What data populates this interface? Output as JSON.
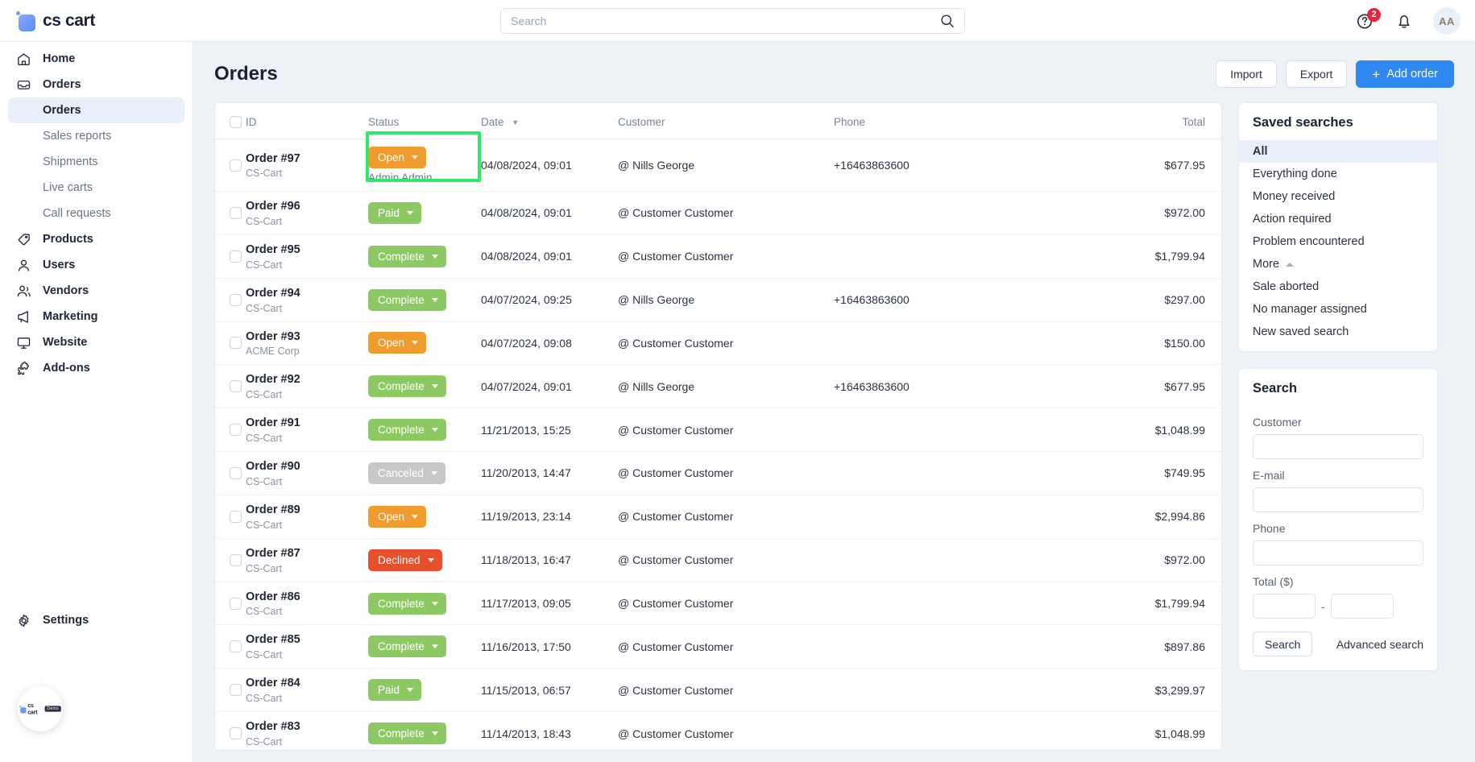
{
  "topbar": {
    "brand": "cs cart",
    "search_placeholder": "Search",
    "search_value": "",
    "help_badge": "2",
    "avatar_initials": "AA"
  },
  "sidebar": {
    "items": [
      {
        "label": "Home",
        "icon": "home-icon",
        "type": "main"
      },
      {
        "label": "Orders",
        "icon": "inbox-icon",
        "type": "main"
      },
      {
        "label": "Orders",
        "icon": "",
        "type": "sub",
        "active": true
      },
      {
        "label": "Sales reports",
        "icon": "",
        "type": "sub"
      },
      {
        "label": "Shipments",
        "icon": "",
        "type": "sub"
      },
      {
        "label": "Live carts",
        "icon": "",
        "type": "sub"
      },
      {
        "label": "Call requests",
        "icon": "",
        "type": "sub"
      },
      {
        "label": "Products",
        "icon": "tag-icon",
        "type": "main"
      },
      {
        "label": "Users",
        "icon": "user-icon",
        "type": "main"
      },
      {
        "label": "Vendors",
        "icon": "users-icon",
        "type": "main"
      },
      {
        "label": "Marketing",
        "icon": "megaphone-icon",
        "type": "main"
      },
      {
        "label": "Website",
        "icon": "monitor-icon",
        "type": "main"
      },
      {
        "label": "Add-ons",
        "icon": "puzzle-icon",
        "type": "main"
      }
    ],
    "settings": {
      "label": "Settings",
      "icon": "gear-icon"
    },
    "demo_widget": {
      "brand": "cs cart",
      "badge": "Demo"
    }
  },
  "page": {
    "title": "Orders",
    "buttons": {
      "import": "Import",
      "export": "Export",
      "add_order": "Add order",
      "add_icon": "plus-icon"
    }
  },
  "table": {
    "columns": [
      "ID",
      "Status",
      "Date",
      "Customer",
      "Phone",
      "Total"
    ],
    "sorted_column": "Date",
    "sort_direction": "desc",
    "status_colors": {
      "Open": "#ef9b2e",
      "Paid": "#8dc963",
      "Complete": "#8dc963",
      "Canceled": "#c8c8c8",
      "Declined": "#e8502c"
    },
    "rows": [
      {
        "id": "Order #97",
        "store": "CS-Cart",
        "status": "Open",
        "assignee": "Admin Admin",
        "highlighted": true,
        "date": "04/08/2024, 09:01",
        "customer": "@ Nills George",
        "phone": "+16463863600",
        "total": "$677.95"
      },
      {
        "id": "Order #96",
        "store": "CS-Cart",
        "status": "Paid",
        "assignee": "",
        "highlighted": false,
        "date": "04/08/2024, 09:01",
        "customer": "@ Customer Customer",
        "phone": "",
        "total": "$972.00"
      },
      {
        "id": "Order #95",
        "store": "CS-Cart",
        "status": "Complete",
        "assignee": "",
        "highlighted": false,
        "date": "04/08/2024, 09:01",
        "customer": "@ Customer Customer",
        "phone": "",
        "total": "$1,799.94"
      },
      {
        "id": "Order #94",
        "store": "CS-Cart",
        "status": "Complete",
        "assignee": "",
        "highlighted": false,
        "date": "04/07/2024, 09:25",
        "customer": "@ Nills George",
        "phone": "+16463863600",
        "total": "$297.00"
      },
      {
        "id": "Order #93",
        "store": "ACME Corp",
        "status": "Open",
        "assignee": "",
        "highlighted": false,
        "date": "04/07/2024, 09:08",
        "customer": "@ Customer Customer",
        "phone": "",
        "total": "$150.00"
      },
      {
        "id": "Order #92",
        "store": "CS-Cart",
        "status": "Complete",
        "assignee": "",
        "highlighted": false,
        "date": "04/07/2024, 09:01",
        "customer": "@ Nills George",
        "phone": "+16463863600",
        "total": "$677.95"
      },
      {
        "id": "Order #91",
        "store": "CS-Cart",
        "status": "Complete",
        "assignee": "",
        "highlighted": false,
        "date": "11/21/2013, 15:25",
        "customer": "@ Customer Customer",
        "phone": "",
        "total": "$1,048.99"
      },
      {
        "id": "Order #90",
        "store": "CS-Cart",
        "status": "Canceled",
        "assignee": "",
        "highlighted": false,
        "date": "11/20/2013, 14:47",
        "customer": "@ Customer Customer",
        "phone": "",
        "total": "$749.95"
      },
      {
        "id": "Order #89",
        "store": "CS-Cart",
        "status": "Open",
        "assignee": "",
        "highlighted": false,
        "date": "11/19/2013, 23:14",
        "customer": "@ Customer Customer",
        "phone": "",
        "total": "$2,994.86"
      },
      {
        "id": "Order #87",
        "store": "CS-Cart",
        "status": "Declined",
        "assignee": "",
        "highlighted": false,
        "date": "11/18/2013, 16:47",
        "customer": "@ Customer Customer",
        "phone": "",
        "total": "$972.00"
      },
      {
        "id": "Order #86",
        "store": "CS-Cart",
        "status": "Complete",
        "assignee": "",
        "highlighted": false,
        "date": "11/17/2013, 09:05",
        "customer": "@ Customer Customer",
        "phone": "",
        "total": "$1,799.94"
      },
      {
        "id": "Order #85",
        "store": "CS-Cart",
        "status": "Complete",
        "assignee": "",
        "highlighted": false,
        "date": "11/16/2013, 17:50",
        "customer": "@ Customer Customer",
        "phone": "",
        "total": "$897.86"
      },
      {
        "id": "Order #84",
        "store": "CS-Cart",
        "status": "Paid",
        "assignee": "",
        "highlighted": false,
        "date": "11/15/2013, 06:57",
        "customer": "@ Customer Customer",
        "phone": "",
        "total": "$3,299.97"
      },
      {
        "id": "Order #83",
        "store": "CS-Cart",
        "status": "Complete",
        "assignee": "",
        "highlighted": false,
        "date": "11/14/2013, 18:43",
        "customer": "@ Customer Customer",
        "phone": "",
        "total": "$1,048.99"
      }
    ]
  },
  "saved_searches": {
    "title": "Saved searches",
    "items": [
      {
        "label": "All",
        "active": true
      },
      {
        "label": "Everything done",
        "active": false
      },
      {
        "label": "Money received",
        "active": false
      },
      {
        "label": "Action required",
        "active": false
      },
      {
        "label": "Problem encountered",
        "active": false
      },
      {
        "label": "More",
        "active": false,
        "chevron": "chevron-up-icon"
      },
      {
        "label": "Sale aborted",
        "active": false
      },
      {
        "label": "No manager assigned",
        "active": false
      },
      {
        "label": "New saved search",
        "active": false
      }
    ]
  },
  "search_panel": {
    "title": "Search",
    "fields": [
      {
        "label": "Customer",
        "value": "",
        "name": "customer"
      },
      {
        "label": "E-mail",
        "value": "",
        "name": "email"
      },
      {
        "label": "Phone",
        "value": "",
        "name": "phone"
      }
    ],
    "total_label": "Total ($)",
    "total_from": "",
    "total_to": "",
    "range_separator": "-",
    "search_button": "Search",
    "advanced_link": "Advanced search"
  }
}
